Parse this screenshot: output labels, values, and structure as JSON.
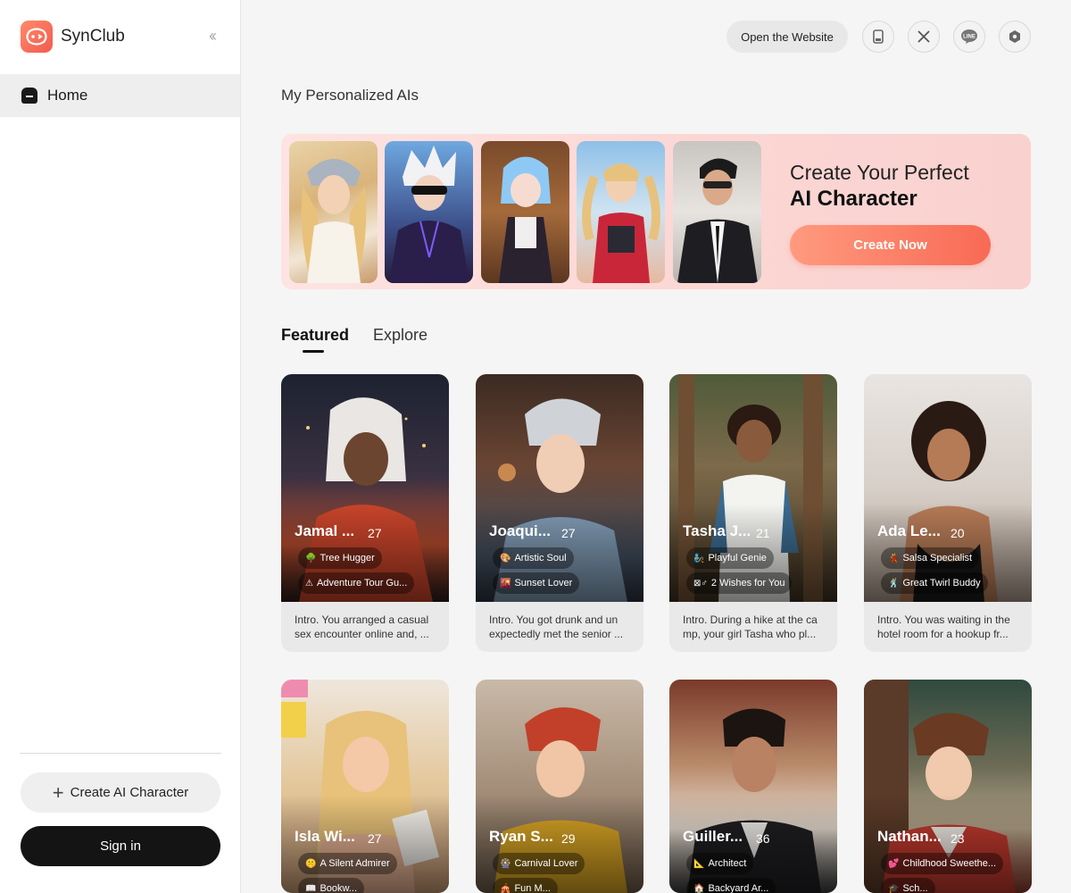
{
  "app": {
    "name": "SynClub"
  },
  "sidebar": {
    "home_label": "Home",
    "create_ai_label": "Create AI Character",
    "signin_label": "Sign in"
  },
  "topbar": {
    "open_website_label": "Open the Website",
    "icons": [
      "tablet-icon",
      "x-icon",
      "line-icon",
      "hexagon-icon"
    ]
  },
  "main": {
    "section_title": "My Personalized AIs",
    "banner": {
      "title_line1": "Create Your Perfect",
      "title_line2": "AI Character",
      "button_label": "Create Now"
    },
    "tabs": [
      {
        "label": "Featured",
        "active": true
      },
      {
        "label": "Explore",
        "active": false
      }
    ],
    "cards": [
      {
        "name": "Jamal ...",
        "age": "27",
        "tags": [
          {
            "icon": "🌳",
            "text": "Tree Hugger"
          },
          {
            "icon": "⚠",
            "text": "Adventure Tour Gu..."
          }
        ],
        "intro": "Intro. You arranged a casual sex encounter online and, ..."
      },
      {
        "name": "Joaqui...",
        "age": "27",
        "tags": [
          {
            "icon": "🎨",
            "text": "Artistic Soul"
          },
          {
            "icon": "🌇",
            "text": "Sunset Lover"
          }
        ],
        "intro": "Intro. You got drunk and un expectedly met the senior ..."
      },
      {
        "name": "Tasha J...",
        "age": "21",
        "tags": [
          {
            "icon": "🧞",
            "text": "Playful Genie"
          },
          {
            "icon": "⊠♂",
            "text": "2 Wishes for You"
          }
        ],
        "intro": "Intro. During a hike at the ca mp, your girl Tasha who pl..."
      },
      {
        "name": "Ada Le...",
        "age": "20",
        "tags": [
          {
            "icon": "💃",
            "text": "Salsa Specialist"
          },
          {
            "icon": "🕺",
            "text": "Great Twirl Buddy"
          }
        ],
        "intro": "Intro. You was waiting in the hotel room for a hookup fr..."
      },
      {
        "name": "Isla Wi...",
        "age": "27",
        "tags": [
          {
            "icon": "🤫",
            "text": "A Silent Admirer"
          },
          {
            "icon": "📖",
            "text": "Bookw..."
          }
        ],
        "intro": ""
      },
      {
        "name": "Ryan S...",
        "age": "29",
        "tags": [
          {
            "icon": "🎡",
            "text": "Carnival Lover"
          },
          {
            "icon": "🎪",
            "text": "Fun M..."
          }
        ],
        "intro": ""
      },
      {
        "name": "Guiller...",
        "age": "36",
        "tags": [
          {
            "icon": "📐",
            "text": "Architect"
          },
          {
            "icon": "🏠",
            "text": "Backyard Ar..."
          }
        ],
        "intro": ""
      },
      {
        "name": "Nathan...",
        "age": "23",
        "tags": [
          {
            "icon": "💕",
            "text": "Childhood Sweethe..."
          },
          {
            "icon": "🎓",
            "text": "Sch..."
          }
        ],
        "intro": ""
      }
    ]
  },
  "colors": {
    "accent": "#f86a55",
    "banner_bg": "#fbd6d3",
    "signin_bg": "#141414"
  }
}
